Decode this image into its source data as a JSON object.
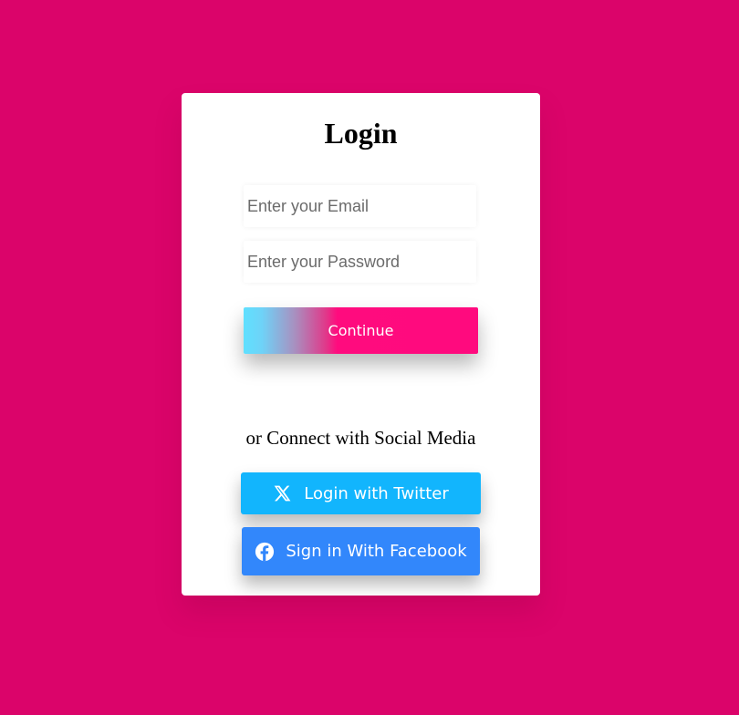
{
  "login": {
    "title": "Login",
    "email_placeholder": "Enter your Email",
    "password_placeholder": "Enter your Password",
    "continue_label": "Continue"
  },
  "social": {
    "divider_text": "or Connect with Social Media",
    "twitter_label": "Login with Twitter",
    "facebook_label": "Sign in With Facebook",
    "twitter_icon": "x-logo-icon",
    "facebook_icon": "facebook-logo-icon"
  },
  "colors": {
    "background": "#db046a",
    "card": "#ffffff",
    "twitter_button": "#12b5fd",
    "facebook_button": "#3287fb",
    "continue_gradient_start": "#5fe0ff",
    "continue_gradient_end": "#ff0a7e"
  }
}
